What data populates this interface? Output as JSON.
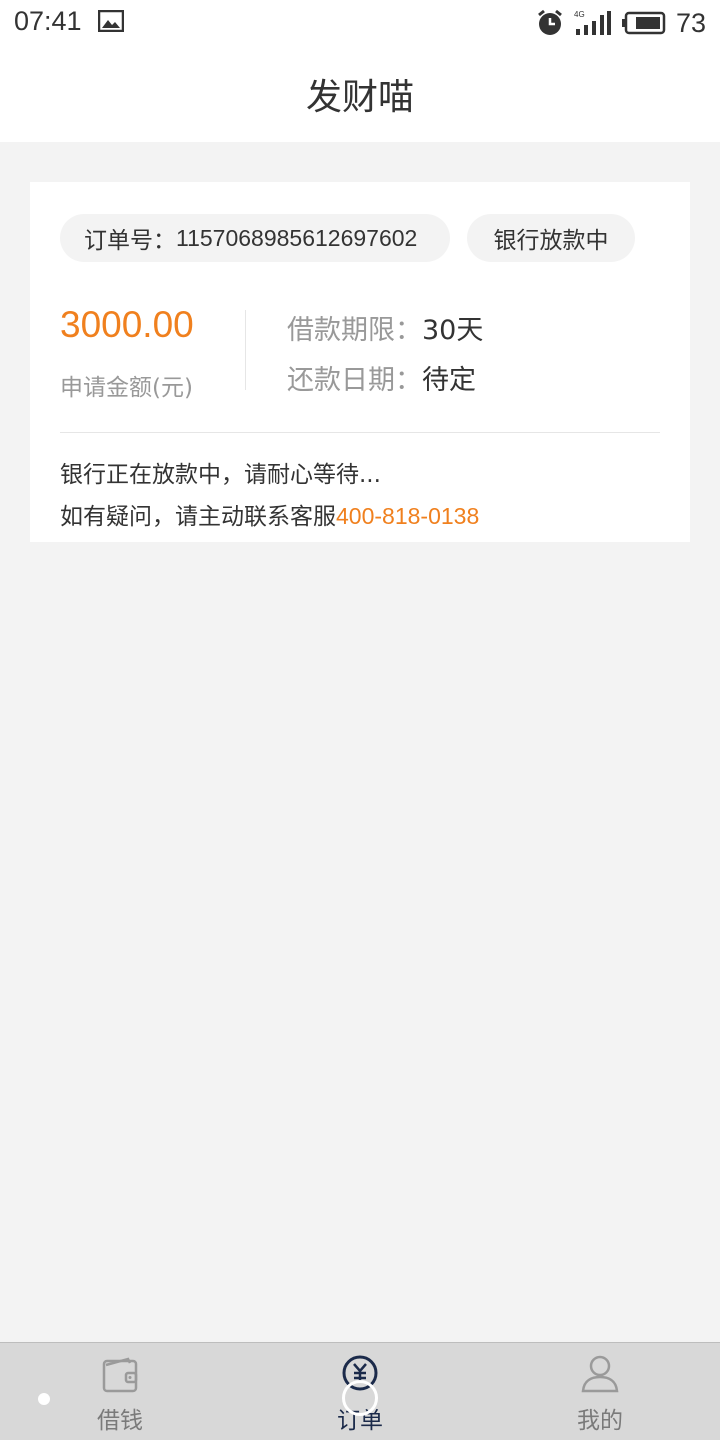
{
  "status_bar": {
    "time": "07:41",
    "network": "4G",
    "battery": "73"
  },
  "header": {
    "title": "发财喵"
  },
  "order_card": {
    "order_label": "订单号：",
    "order_number": "1157068985612697602",
    "status": "银行放款中",
    "amount": "3000.00",
    "amount_label": "申请金额(元)",
    "term_label": "借款期限：",
    "term_value": "30天",
    "repay_label": "还款日期：",
    "repay_value": "待定",
    "message_line1": "银行正在放款中，请耐心等待...",
    "message_line2_prefix": "如有疑问，请主动联系客服",
    "phone": "400-818-0138"
  },
  "tabbar": {
    "tabs": [
      {
        "label": "借钱",
        "icon": "wallet-icon",
        "active": false
      },
      {
        "label": "订单",
        "icon": "yen-coin-icon",
        "active": true
      },
      {
        "label": "我的",
        "icon": "user-icon",
        "active": false
      }
    ]
  },
  "colors": {
    "accent": "#f0801e",
    "active_tab": "#1b2a4a",
    "background": "#f3f3f3"
  }
}
